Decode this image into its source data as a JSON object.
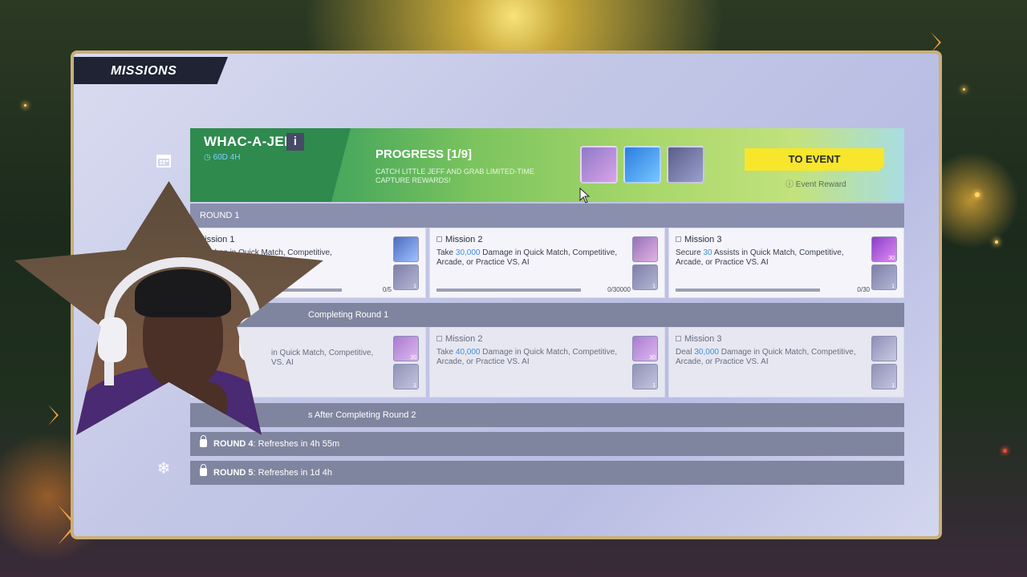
{
  "header": {
    "title": "MISSIONS"
  },
  "event": {
    "title": "WHAC-A-JEFF",
    "info_badge": "i",
    "timer": "60D 4H",
    "progress_label": "PROGRESS",
    "progress_value": "[1/9]",
    "description": "CATCH LITTLE JEFF AND GRAB LIMITED-TIME CAPTURE REWARDS!",
    "to_event_button": "TO EVENT",
    "event_reward_link": "Event Reward",
    "reward_icons": [
      "character-spray-icon",
      "blue-chest-icon",
      "shark-avatar-icon"
    ]
  },
  "rounds": [
    {
      "label": "ROUND 1",
      "missions": [
        {
          "title": "Mission 1",
          "desc_pre": "",
          "highlight": "",
          "desc_post": "matches in Quick Match, Competitive,",
          "desc_line2": "",
          "progress": "0/5",
          "rewards": [
            "shark-icon",
            "scroll-icon"
          ],
          "reward_qty": [
            "",
            "1"
          ]
        },
        {
          "title": "Mission 2",
          "desc_pre": "Take ",
          "highlight": "30,000",
          "desc_post": " Damage in Quick Match, Competitive,",
          "desc_line2": "Arcade, or Practice VS. AI",
          "progress": "0/30000",
          "rewards": [
            "character-icon",
            "scroll-icon"
          ],
          "reward_qty": [
            "",
            "1"
          ]
        },
        {
          "title": "Mission 3",
          "desc_pre": "Secure ",
          "highlight": "30",
          "desc_post": " Assists in Quick Match, Competitive,",
          "desc_line2": "Arcade, or Practice VS. AI",
          "progress": "0/30",
          "rewards": [
            "crystal-icon",
            "scroll-icon"
          ],
          "reward_qty": [
            "30",
            "1"
          ]
        }
      ]
    },
    {
      "label": "Completing Round 1",
      "missions": [
        {
          "title": "",
          "desc_pre": "",
          "highlight": "",
          "desc_post": "in Quick Match, Competitive,",
          "desc_line2": "VS. AI",
          "progress": "",
          "rewards": [
            "crystal-icon",
            "scroll-icon"
          ],
          "reward_qty": [
            "30",
            "1"
          ]
        },
        {
          "title": "Mission 2",
          "desc_pre": "Take ",
          "highlight": "40,000",
          "desc_post": " Damage in Quick Match, Competitive,",
          "desc_line2": "Arcade, or Practice VS. AI",
          "progress": "",
          "rewards": [
            "crystal-icon",
            "scroll-icon"
          ],
          "reward_qty": [
            "30",
            "1"
          ]
        },
        {
          "title": "Mission 3",
          "desc_pre": "Deal ",
          "highlight": "30,000",
          "desc_post": " Damage in Quick Match, Competitive,",
          "desc_line2": "Arcade, or Practice VS. AI",
          "progress": "",
          "rewards": [
            "spray-icon",
            "scroll-icon"
          ],
          "reward_qty": [
            "",
            "1"
          ]
        }
      ]
    }
  ],
  "round3_label": "s After Completing Round 2",
  "round4": {
    "name": "ROUND 4",
    "text": ": Refreshes in 4h 55m"
  },
  "round5": {
    "name": "ROUND 5",
    "text": ": Refreshes in 1d 4h"
  },
  "sidebar_icons": [
    "calendar-icon",
    "snowflake-icon"
  ]
}
